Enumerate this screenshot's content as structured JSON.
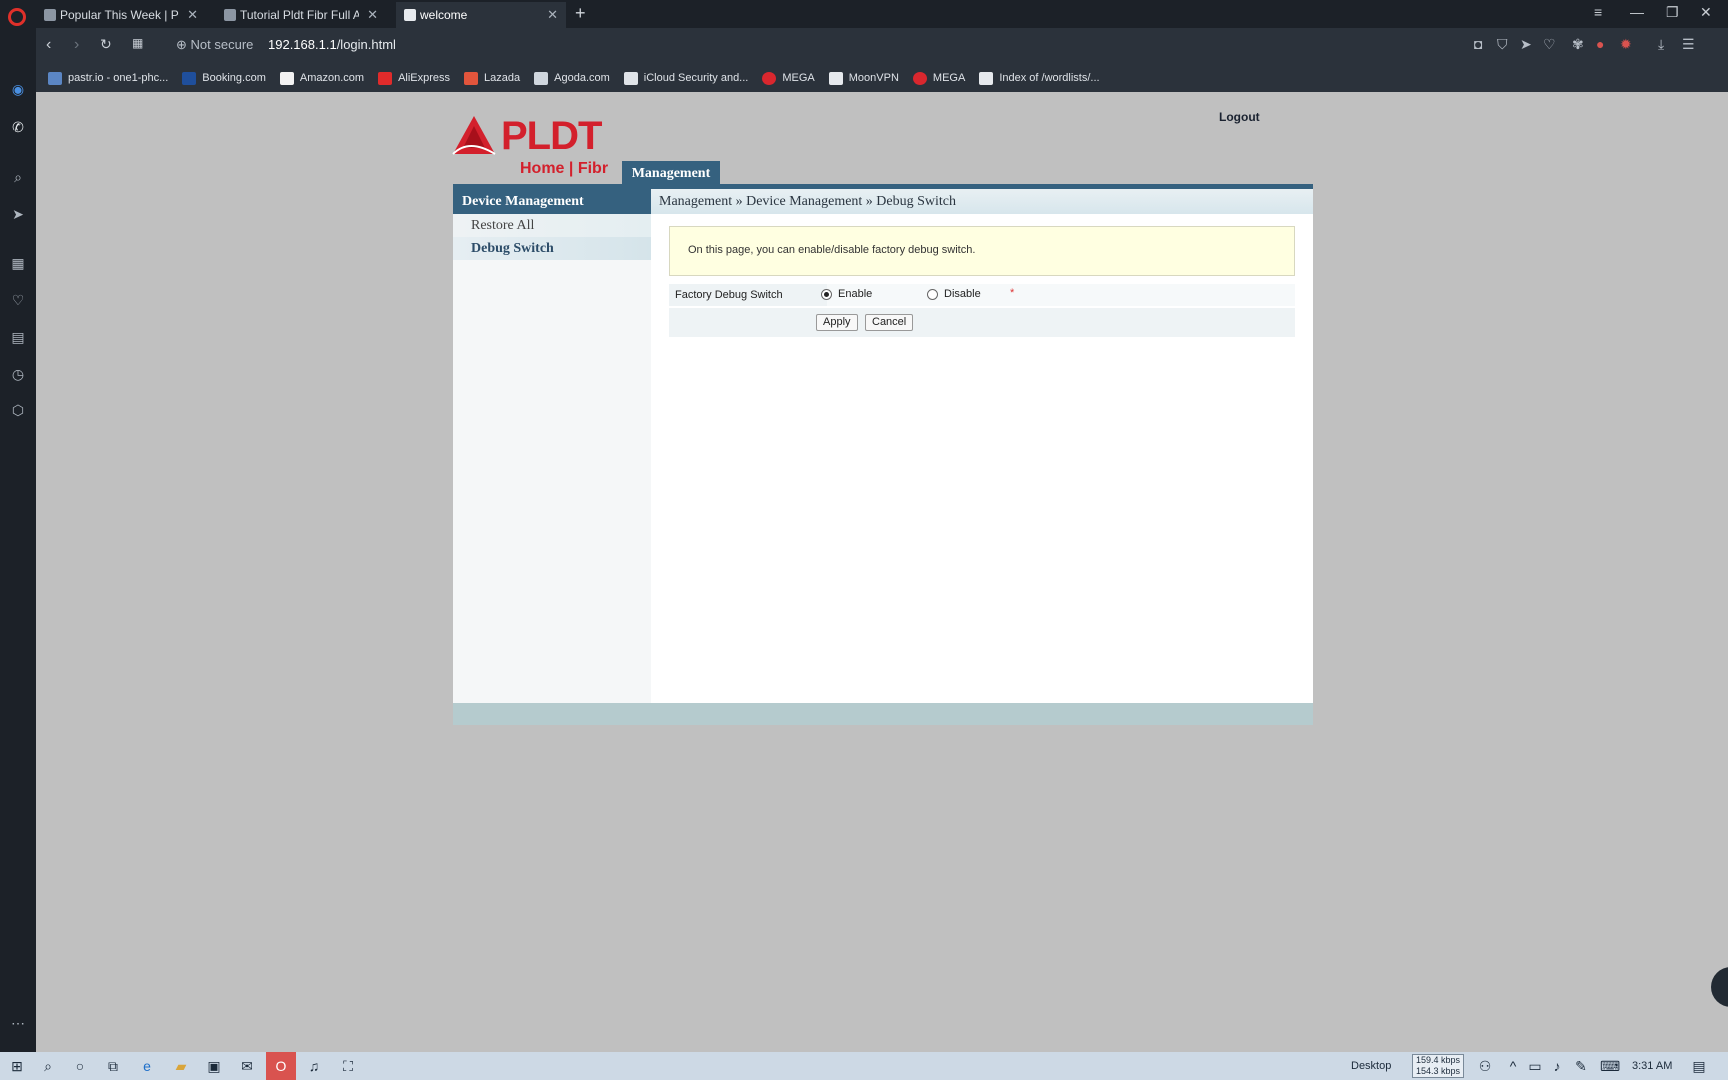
{
  "browser": {
    "tabs": [
      {
        "title": "Popular This Week | Pinoy I"
      },
      {
        "title": "Tutorial Pldt Fibr Full Admi"
      },
      {
        "title": "welcome"
      }
    ],
    "security_label": "Not secure",
    "url_host": "192.168.1.1",
    "url_path": "/login.html",
    "bookmarks": [
      "pastr.io - one1-phc...",
      "Booking.com",
      "Amazon.com",
      "AliExpress",
      "Lazada",
      "Agoda.com",
      "iCloud Security and...",
      "MEGA",
      "MoonVPN",
      "MEGA",
      "Index of /wordlists/..."
    ]
  },
  "router": {
    "logo_text": "PLDT",
    "logo_sub": "Home | Fibr",
    "logout": "Logout",
    "top_tab": "Management",
    "leftnav": {
      "header": "Device Management",
      "items": [
        "Restore All",
        "Debug Switch"
      ]
    },
    "breadcrumb": "Management » Device Management » Debug Switch",
    "notice": "On this page, you can enable/disable factory debug switch.",
    "field_label": "Factory Debug Switch",
    "option_enable": "Enable",
    "option_disable": "Disable",
    "required_mark": "*",
    "apply": "Apply",
    "cancel": "Cancel"
  },
  "taskbar": {
    "desktop_label": "Desktop",
    "net_up": "159.4 kbps",
    "net_down": "154.3 kbps",
    "time": "3:31 AM"
  },
  "colors": {
    "accent": "#35617f",
    "brand_red": "#d3202c"
  }
}
